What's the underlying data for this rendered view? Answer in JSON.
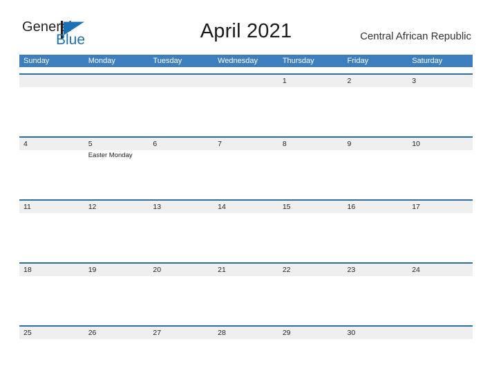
{
  "brand": {
    "name_part1": "General",
    "name_part2": "Blue",
    "flag_icon": "flag-triangle-icon",
    "blue_hex": "#1b70b8",
    "dark_hex": "#231f20"
  },
  "header": {
    "title": "April 2021",
    "month": "April",
    "year": "2021",
    "region": "Central African Republic"
  },
  "theme": {
    "header_blue": "#3d7ebf",
    "row_border_blue": "#2e6da4",
    "date_band_gray": "#efefef",
    "page_background": "#ffffff",
    "text_dark": "#222222"
  },
  "weekdays": [
    {
      "label": "Sunday"
    },
    {
      "label": "Monday"
    },
    {
      "label": "Tuesday"
    },
    {
      "label": "Wednesday"
    },
    {
      "label": "Thursday"
    },
    {
      "label": "Friday"
    },
    {
      "label": "Saturday"
    }
  ],
  "weeks": [
    {
      "days": [
        {
          "date": "",
          "events": []
        },
        {
          "date": "",
          "events": []
        },
        {
          "date": "",
          "events": []
        },
        {
          "date": "",
          "events": []
        },
        {
          "date": "1",
          "events": []
        },
        {
          "date": "2",
          "events": []
        },
        {
          "date": "3",
          "events": []
        }
      ]
    },
    {
      "days": [
        {
          "date": "4",
          "events": []
        },
        {
          "date": "5",
          "events": [
            {
              "name": "Easter Monday"
            }
          ]
        },
        {
          "date": "6",
          "events": []
        },
        {
          "date": "7",
          "events": []
        },
        {
          "date": "8",
          "events": []
        },
        {
          "date": "9",
          "events": []
        },
        {
          "date": "10",
          "events": []
        }
      ]
    },
    {
      "days": [
        {
          "date": "11",
          "events": []
        },
        {
          "date": "12",
          "events": []
        },
        {
          "date": "13",
          "events": []
        },
        {
          "date": "14",
          "events": []
        },
        {
          "date": "15",
          "events": []
        },
        {
          "date": "16",
          "events": []
        },
        {
          "date": "17",
          "events": []
        }
      ]
    },
    {
      "days": [
        {
          "date": "18",
          "events": []
        },
        {
          "date": "19",
          "events": []
        },
        {
          "date": "20",
          "events": []
        },
        {
          "date": "21",
          "events": []
        },
        {
          "date": "22",
          "events": []
        },
        {
          "date": "23",
          "events": []
        },
        {
          "date": "24",
          "events": []
        }
      ]
    },
    {
      "days": [
        {
          "date": "25",
          "events": []
        },
        {
          "date": "26",
          "events": []
        },
        {
          "date": "27",
          "events": []
        },
        {
          "date": "28",
          "events": []
        },
        {
          "date": "29",
          "events": []
        },
        {
          "date": "30",
          "events": []
        },
        {
          "date": "",
          "events": []
        }
      ]
    }
  ]
}
